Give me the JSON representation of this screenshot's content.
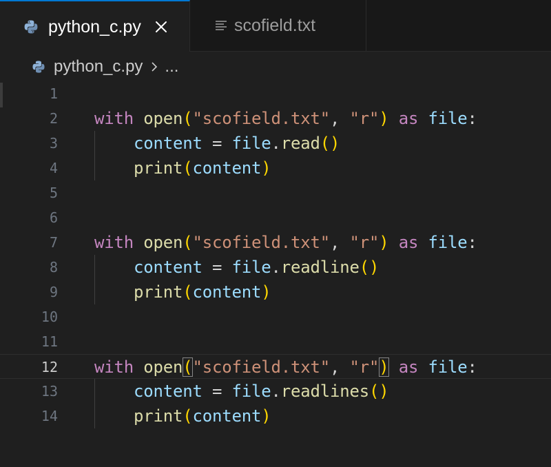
{
  "tabs": [
    {
      "label": "python_c.py",
      "active": true,
      "icon": "python-icon"
    },
    {
      "label": "scofield.txt",
      "active": false,
      "icon": "text-lines-icon"
    }
  ],
  "breadcrumb": {
    "file": "python_c.py",
    "separator_icon": "chevron-right-icon",
    "more": "..."
  },
  "editor": {
    "current_line": 12,
    "line_numbers": [
      "1",
      "2",
      "3",
      "4",
      "5",
      "6",
      "7",
      "8",
      "9",
      "10",
      "11",
      "12",
      "13",
      "14"
    ],
    "tokens": {
      "with": "with",
      "open": "open",
      "lparen": "(",
      "rparen": ")",
      "filename": "\"scofield.txt\"",
      "comma": ", ",
      "mode": "\"r\"",
      "as": "as",
      "file": "file",
      "colon": ":",
      "content": "content",
      "eq": " = ",
      "dot": ".",
      "read": "read",
      "readline": "readline",
      "readlines": "readlines",
      "print": "print",
      "call": "()"
    }
  },
  "colors": {
    "keyword": "#c586c0",
    "function": "#dcdcaa",
    "string": "#ce9178",
    "variable": "#9cdcfe",
    "bracket_level1": "#ffd700",
    "bracket_level2": "#da70d6",
    "accent": "#0078d4"
  }
}
